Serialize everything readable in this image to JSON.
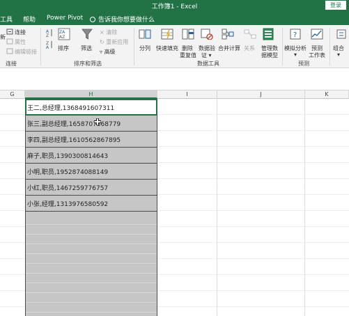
{
  "window": {
    "title": "工作簿1 - Excel",
    "login_label": "登录"
  },
  "menu": {
    "items": [
      "工具",
      "帮助",
      "Power Pivot"
    ],
    "tell_me": "告诉我你想要做什么"
  },
  "ribbon": {
    "conn_group": {
      "refresh_label": "新",
      "connections": "连接",
      "properties": "属性",
      "edit_links": "编辑链接",
      "label": "连接"
    },
    "sort_group": {
      "sort": "排序",
      "filter": "筛选",
      "clear": "清除",
      "reapply": "重新应用",
      "advanced": "高级",
      "label": "排序和筛选"
    },
    "data_tools": {
      "split": "分列",
      "flash_fill": "快速填充",
      "remove_dup_1": "删除",
      "remove_dup_2": "重复值",
      "validation_1": "数据验",
      "validation_2": "证 ▾",
      "consolidate": "合并计算",
      "relations": "关系",
      "manage_1": "管理数",
      "manage_2": "据模型",
      "label": "数据工具"
    },
    "forecast": {
      "whatif": "模拟分析",
      "sheet_1": "预测",
      "sheet_2": "工作表",
      "label": "预测"
    },
    "outline": {
      "group": "组合"
    }
  },
  "columns": [
    "G",
    "H",
    "I",
    "J",
    "K"
  ],
  "cells": [
    "王二,总经理,1368491607311",
    "张三,副总经理,1658707368779",
    "李四,副总经理,1610562867895",
    "麻子,职员,1390300814643",
    "小明,职员,1952874088149",
    "小红,职员,1467259776757",
    "小张,经理,1313976580592"
  ],
  "colors": {
    "excel_green": "#217346",
    "selection_gray": "#c6c6c6"
  }
}
